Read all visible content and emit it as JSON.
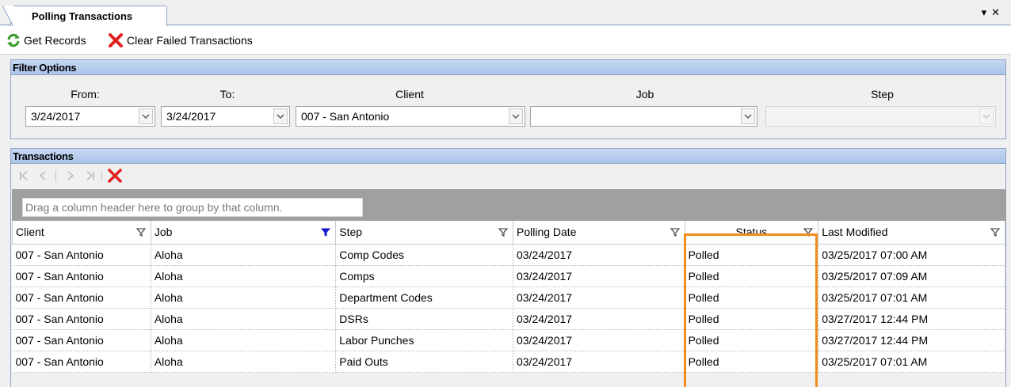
{
  "tab": {
    "title": "Polling Transactions",
    "pin_glyph": "▾",
    "close_glyph": "✕"
  },
  "toolbar": {
    "get_records": "Get Records",
    "clear_failed": "Clear Failed Transactions"
  },
  "filter": {
    "title": "Filter Options",
    "from_label": "From:",
    "from_value": "3/24/2017",
    "to_label": "To:",
    "to_value": "3/24/2017",
    "client_label": "Client",
    "client_value": "007 - San Antonio",
    "job_label": "Job",
    "job_value": "",
    "step_label": "Step",
    "step_value": ""
  },
  "transactions": {
    "title": "Transactions",
    "group_hint": "Drag a column header here to group by that column.",
    "columns": [
      "Client",
      "Job",
      "Step",
      "Polling Date",
      "Status",
      "Last Modified"
    ],
    "rows": [
      [
        "007 - San Antonio",
        "Aloha",
        "Comp Codes",
        "03/24/2017",
        "Polled",
        "03/25/2017 07:00 AM"
      ],
      [
        "007 - San Antonio",
        "Aloha",
        "Comps",
        "03/24/2017",
        "Polled",
        "03/25/2017 07:09 AM"
      ],
      [
        "007 - San Antonio",
        "Aloha",
        "Department Codes",
        "03/24/2017",
        "Polled",
        "03/25/2017 07:01 AM"
      ],
      [
        "007 - San Antonio",
        "Aloha",
        "DSRs",
        "03/24/2017",
        "Polled",
        "03/27/2017 12:44 PM"
      ],
      [
        "007 - San Antonio",
        "Aloha",
        "Labor Punches",
        "03/24/2017",
        "Polled",
        "03/27/2017 12:44 PM"
      ],
      [
        "007 - San Antonio",
        "Aloha",
        "Paid Outs",
        "03/24/2017",
        "Polled",
        "03/25/2017 07:01 AM"
      ]
    ],
    "active_filter_column": "Job"
  },
  "colors": {
    "panel_header": "#b7cdee",
    "highlight": "#f28c1e",
    "active_filter": "#1a1acc",
    "delete": "#e02020"
  }
}
